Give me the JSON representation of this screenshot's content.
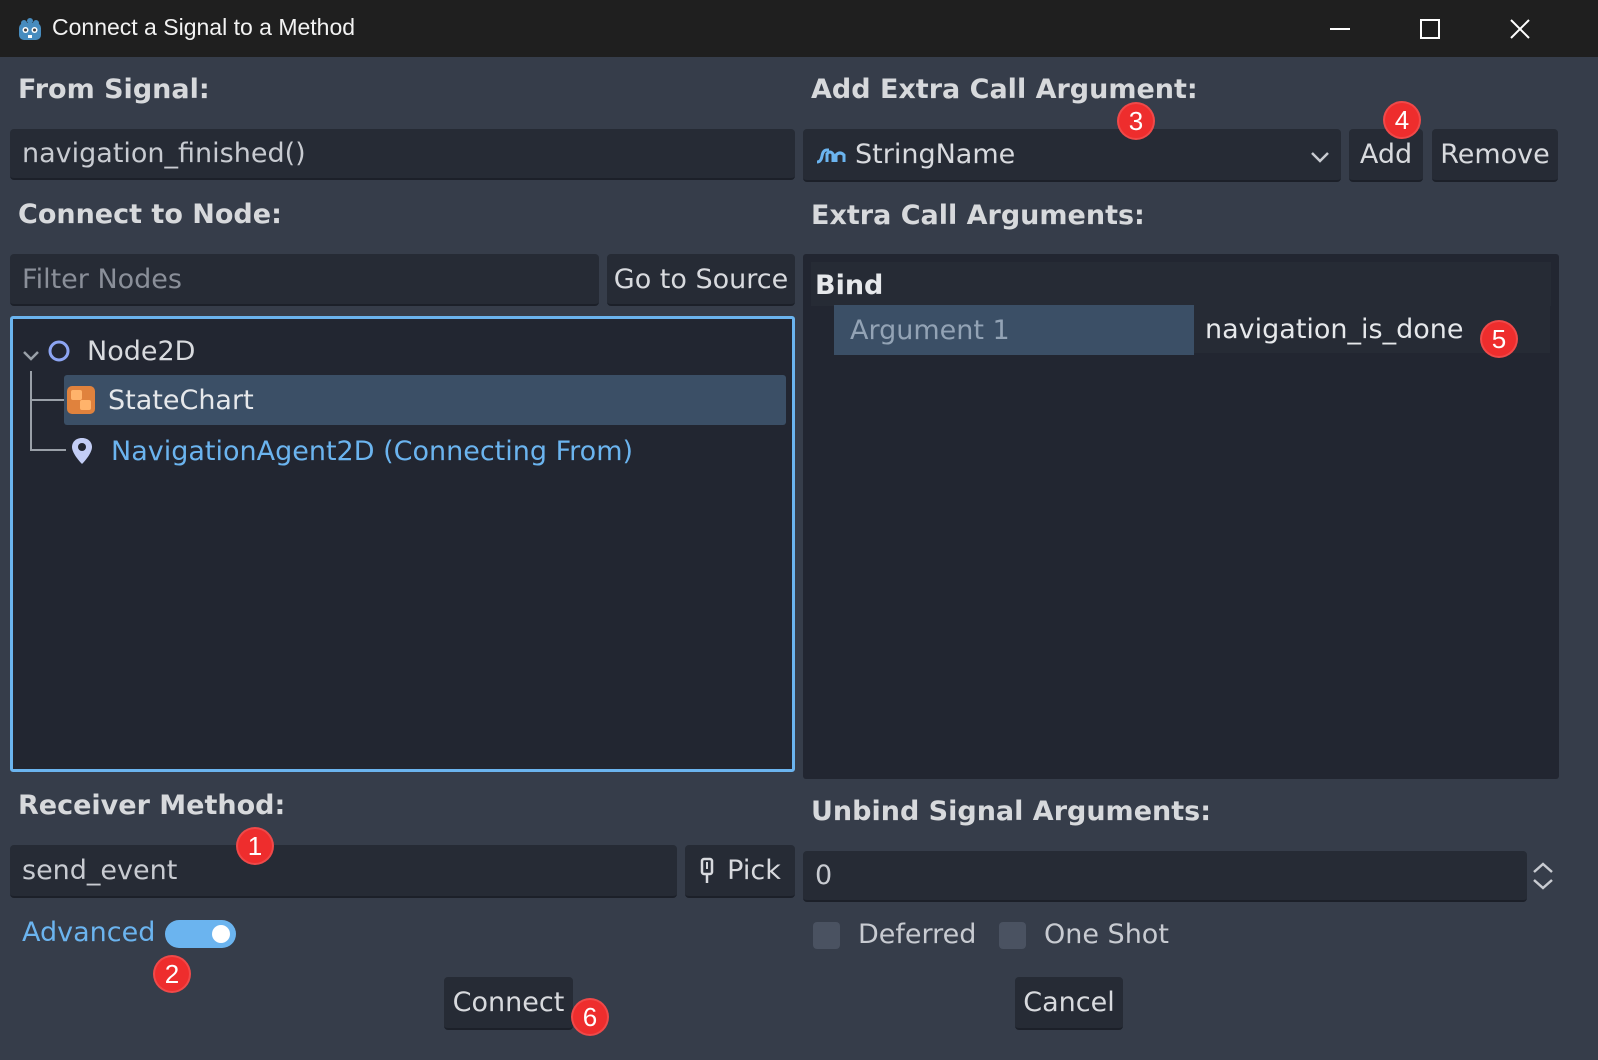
{
  "window": {
    "title": "Connect a Signal to a Method"
  },
  "from_signal": {
    "label": "From Signal:",
    "value": "navigation_finished()"
  },
  "connect_to_node": {
    "label": "Connect to Node:",
    "filter_placeholder": "Filter Nodes",
    "go_to_source_label": "Go to Source",
    "tree": [
      {
        "name": "Node2D",
        "icon": "circle-node-icon",
        "selected": false
      },
      {
        "name": "StateChart",
        "icon": "statechart-icon",
        "selected": true
      },
      {
        "name": "NavigationAgent2D (Connecting From)",
        "icon": "location-pin-icon",
        "selected": false
      }
    ]
  },
  "extra_argument": {
    "label": "Add Extra Call Argument:",
    "type_value": "StringName",
    "type_icon": "stringname-icon",
    "add_label": "Add",
    "remove_label": "Remove"
  },
  "extra_call_arguments": {
    "label": "Extra Call Arguments:",
    "header": "Bind",
    "rows": [
      {
        "name": "Argument 1",
        "value": "navigation_is_done"
      }
    ]
  },
  "receiver_method": {
    "label": "Receiver Method:",
    "value": "send_event",
    "pick_label": "Pick"
  },
  "advanced": {
    "label": "Advanced",
    "enabled": true
  },
  "unbind": {
    "label": "Unbind Signal Arguments:",
    "value": "0"
  },
  "flags": {
    "deferred_label": "Deferred",
    "one_shot_label": "One Shot"
  },
  "actions": {
    "connect_label": "Connect",
    "cancel_label": "Cancel"
  },
  "annotations": [
    "1",
    "2",
    "3",
    "4",
    "5",
    "6"
  ],
  "colors": {
    "accent": "#6bb4ef",
    "badge": "#ee2d2d",
    "node_link": "#6bb4ef",
    "selection": "#3b4f66"
  }
}
